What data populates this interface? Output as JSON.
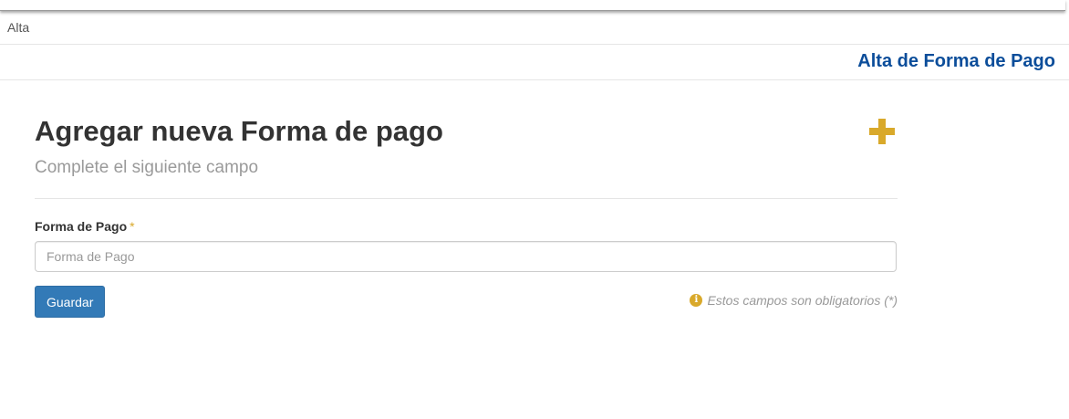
{
  "breadcrumb": {
    "label": "Alta"
  },
  "header": {
    "page_title": "Alta de Forma de Pago"
  },
  "panel": {
    "heading": "Agregar nueva Forma de pago",
    "subtitle": "Complete el siguiente campo",
    "action_icon": "plus-icon",
    "accent_color": "#d9a92b"
  },
  "form": {
    "field_label": "Forma de Pago",
    "required_marker": "*",
    "field_value": "",
    "field_placeholder": "Forma de Pago",
    "submit_label": "Guardar",
    "required_note_icon": "info-icon",
    "required_note_icon_glyph": "i",
    "required_note": "Estos campos son obligatorios (*)"
  },
  "colors": {
    "title": "#0b4d9a",
    "primary_button": "#337ab7"
  }
}
